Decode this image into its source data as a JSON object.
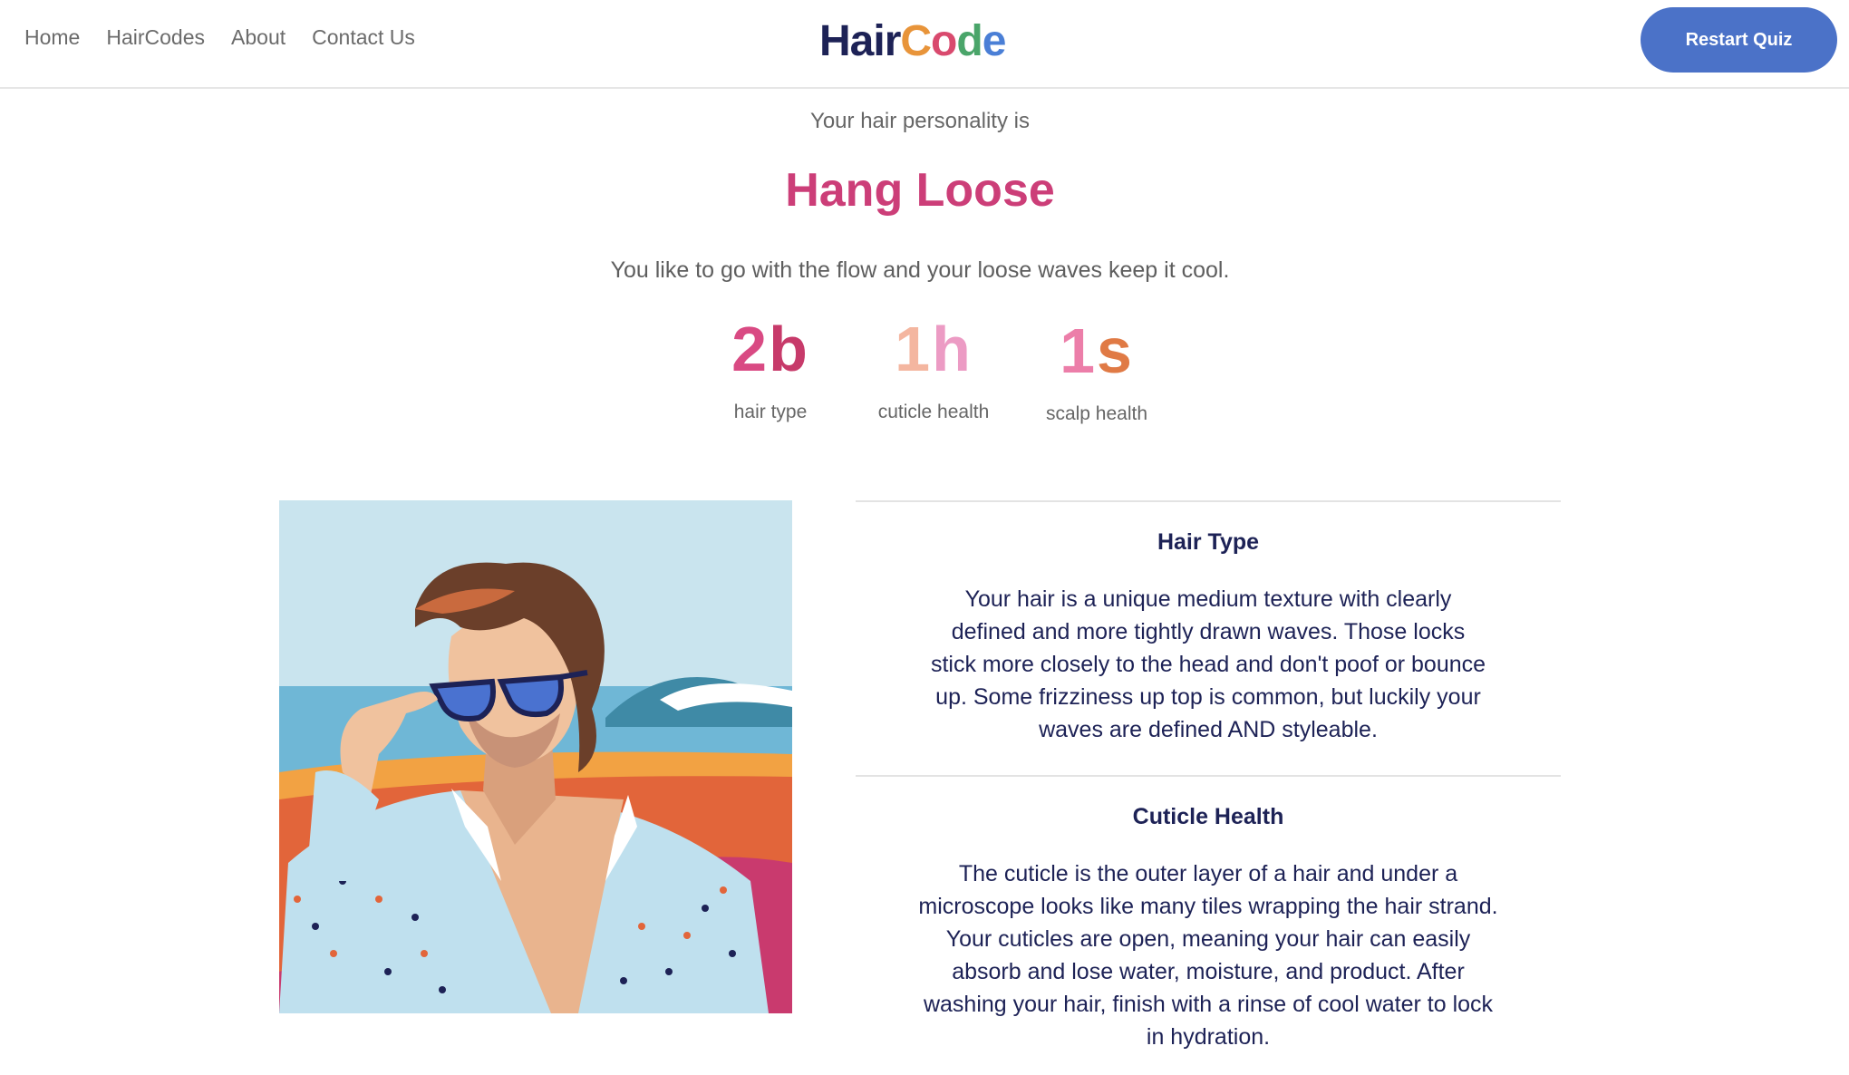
{
  "nav": {
    "items": [
      "Home",
      "HairCodes",
      "About",
      "Contact Us"
    ]
  },
  "logo": {
    "part1": "Hair",
    "part2_letters": [
      "C",
      "o",
      "d",
      "e"
    ]
  },
  "header": {
    "restart_label": "Restart Quiz"
  },
  "result": {
    "intro": "Your hair personality is",
    "personality": "Hang Loose",
    "tagline": "You like to go with the flow and your loose waves keep it cool."
  },
  "codes": [
    {
      "digit": "2",
      "letter": "b",
      "label": "hair type"
    },
    {
      "digit": "1",
      "letter": "h",
      "label": "cuticle health"
    },
    {
      "digit": "1",
      "letter": "s",
      "label": "scalp health"
    }
  ],
  "sections": [
    {
      "title": "Hair Type",
      "text": "Your hair is a unique medium texture with clearly defined and more tightly drawn waves. Those locks stick more closely to the head and don't poof or bounce up. Some frizziness up top is common, but luckily your waves are defined AND styleable."
    },
    {
      "title": "Cuticle Health",
      "text": "The cuticle is the outer layer of a hair and under a microscope looks like many tiles wrapping the hair strand. Your cuticles are open, meaning your hair can easily absorb and lose water, moisture, and product. After washing your hair, finish with a rinse of cool water to lock in hydration."
    }
  ],
  "colors": {
    "accent_pink": "#cc3e78",
    "button_blue": "#4b72c8",
    "navy": "#1d2256"
  }
}
